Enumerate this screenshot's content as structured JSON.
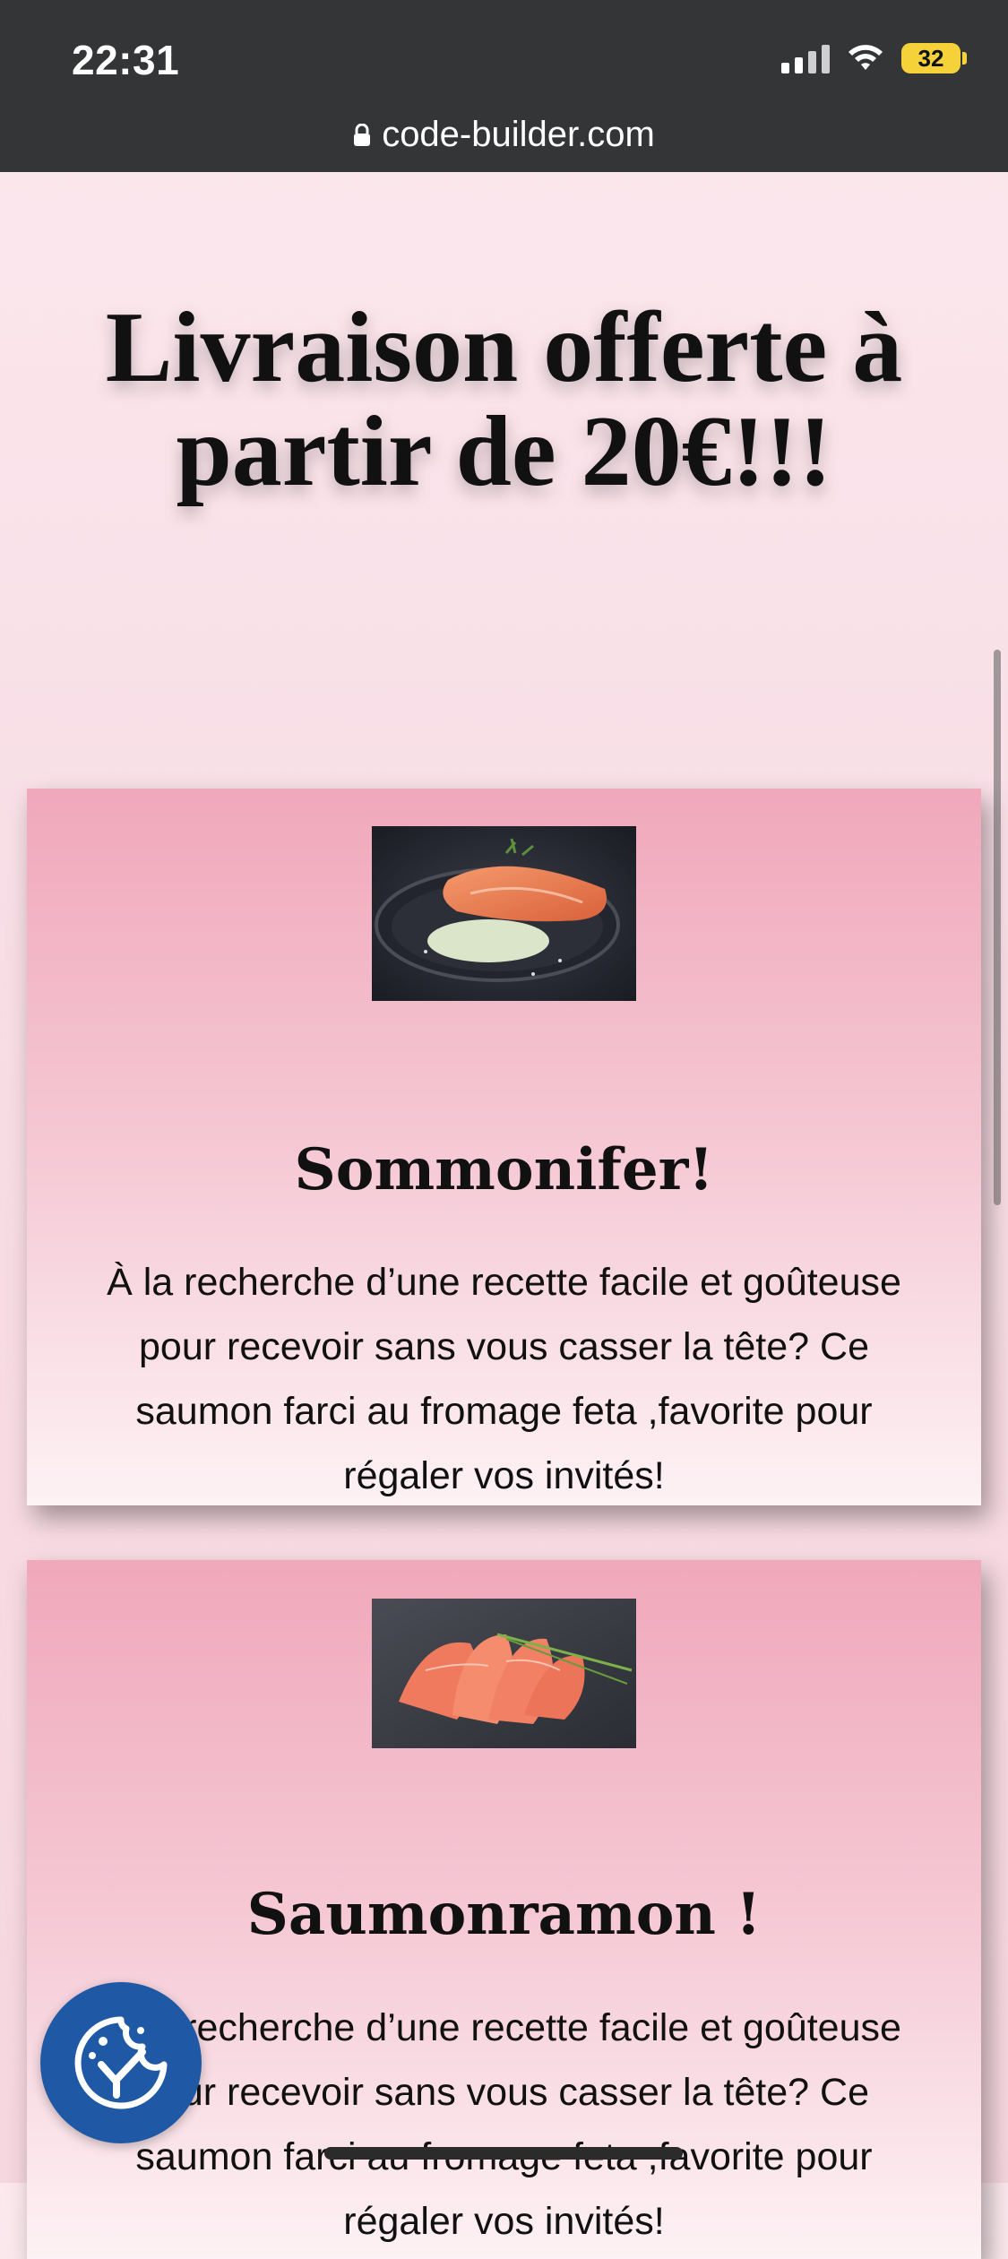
{
  "status_bar": {
    "time": "22:31",
    "battery": "32"
  },
  "browser": {
    "url": "code-builder.com"
  },
  "hero": {
    "title": "Livraison offerte à partir de 20€!!!"
  },
  "cards": [
    {
      "title": "Sommonifer!",
      "text": "À la recherche d’une recette facile et goûteuse pour recevoir sans vous casser la tête? Ce saumon farci au fromage feta ,favorite pour régaler vos invités!"
    },
    {
      "title": "Saumonramon !",
      "text": "À la recherche d’une recette facile et goûteuse pour recevoir sans vous casser la tête? Ce saumon farci au fromage feta ,favorite pour régaler vos invités!"
    }
  ],
  "icons": {
    "lock": "lock-icon",
    "wifi": "wifi-icon",
    "signal": "signal-icon",
    "badge": "cookie-consent-icon"
  },
  "colors": {
    "chrome": "#343536",
    "battery": "#f5d13a",
    "badge": "#1f59a6",
    "card_top": "#f0a8bb",
    "card_bottom": "#fdf2f5"
  }
}
